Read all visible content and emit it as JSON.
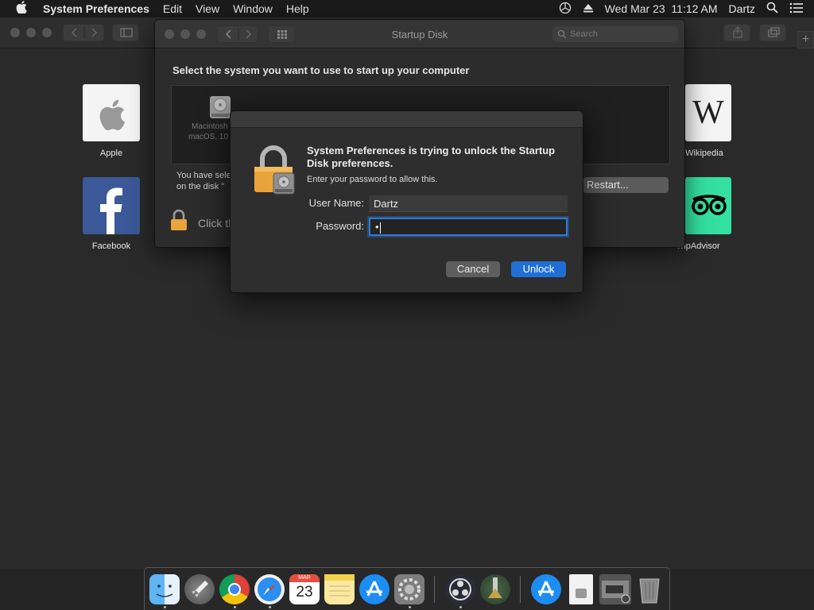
{
  "menubar": {
    "app_name": "System Preferences",
    "menus": [
      "Edit",
      "View",
      "Window",
      "Help"
    ],
    "clock": "Wed Mar 23  11:12 AM",
    "user": "Dartz"
  },
  "background": {
    "tiles": [
      {
        "label": "Apple",
        "icon": "apple-logo-icon"
      },
      {
        "label": "Facebook",
        "icon": "facebook-logo-icon"
      },
      {
        "label": "Wikipedia",
        "icon": "wikipedia-logo-icon"
      },
      {
        "label": "TripAdvisor",
        "icon": "tripadvisor-logo-icon"
      }
    ]
  },
  "startup_disk": {
    "title": "Startup Disk",
    "search_placeholder": "Search",
    "heading": "Select the system you want to use to start up your computer",
    "disk_name": "Macintosh",
    "disk_os": "macOS, 10",
    "info_line1": "You have sele",
    "info_line2": "on the disk \"",
    "lock_text": "Click th",
    "restart_label": "Restart..."
  },
  "dialog": {
    "title": "System Preferences is trying to unlock the Startup Disk preferences.",
    "subtitle": "Enter your password to allow this.",
    "username_label": "User Name:",
    "username_value": "Dartz",
    "password_label": "Password:",
    "password_value": "•",
    "cancel_label": "Cancel",
    "unlock_label": "Unlock"
  },
  "dock": {
    "calendar_month": "MAR",
    "calendar_day": "23",
    "apps": [
      "Finder",
      "Launchpad",
      "Chrome",
      "Safari",
      "Calendar",
      "Notes",
      "App Store",
      "System Preferences",
      "OBS",
      "Utility",
      "App Store",
      "Document",
      "Screenshot",
      "Trash"
    ]
  },
  "colors": {
    "accent": "#1f6fd6",
    "lock_gold": "#e8a33c"
  }
}
